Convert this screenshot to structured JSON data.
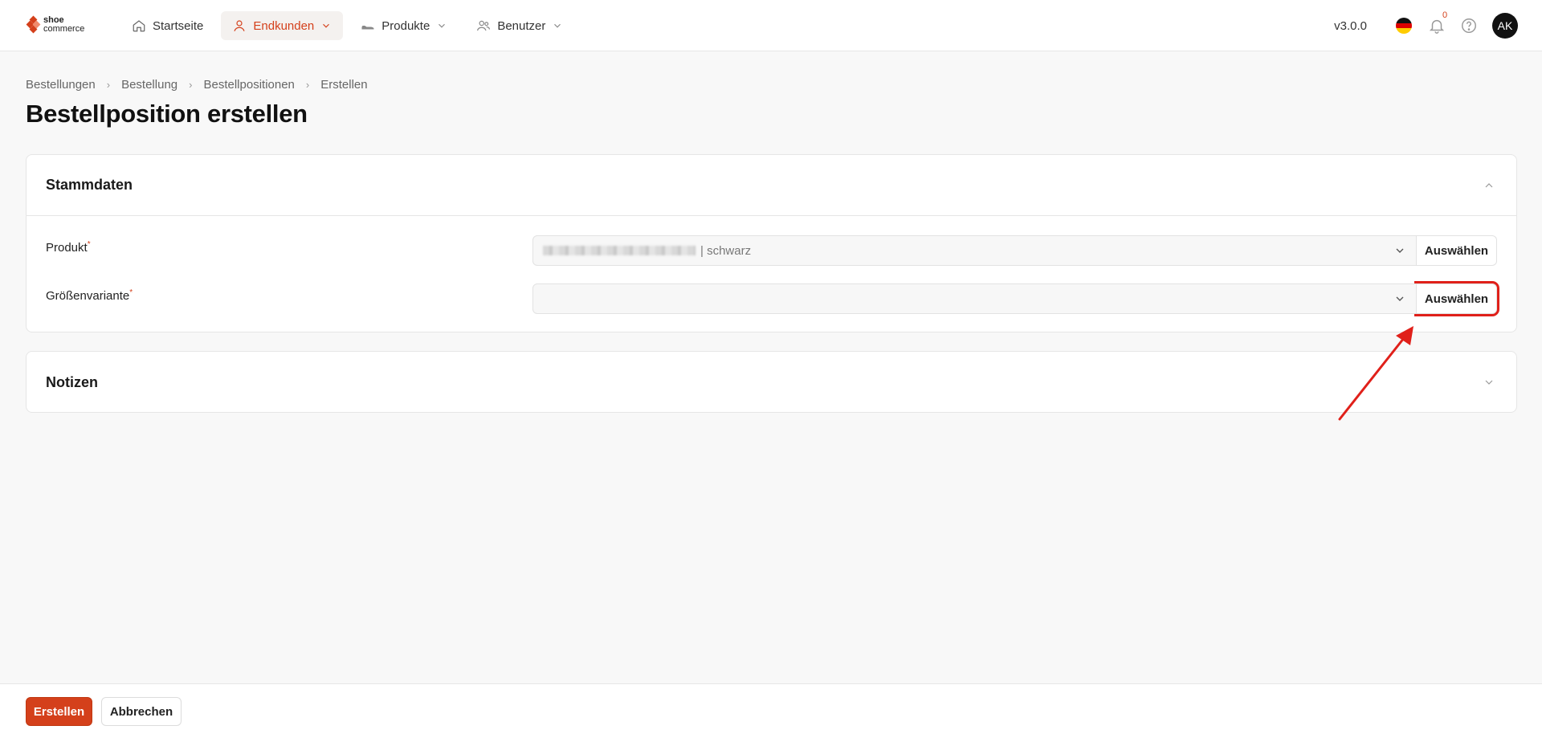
{
  "brand": {
    "logo_line1": "shoe",
    "logo_line2": "commerce"
  },
  "nav": {
    "items": [
      {
        "label": "Startseite",
        "icon": "home-icon"
      },
      {
        "label": "Endkunden",
        "icon": "user-icon",
        "active": true
      },
      {
        "label": "Produkte",
        "icon": "shoe-icon"
      },
      {
        "label": "Benutzer",
        "icon": "users-icon"
      }
    ],
    "version": "v3.0.0",
    "notification_count": "0",
    "avatar_initials": "AK"
  },
  "breadcrumb": [
    "Bestellungen",
    "Bestellung",
    "Bestellpositionen",
    "Erstellen"
  ],
  "page_title": "Bestellposition erstellen",
  "sections": {
    "stammdaten": {
      "title": "Stammdaten",
      "fields": {
        "produkt": {
          "label": "Produkt",
          "value_suffix": "| schwarz",
          "button": "Auswählen"
        },
        "groesse": {
          "label": "Größenvariante",
          "value": "",
          "button": "Auswählen"
        }
      }
    },
    "notizen": {
      "title": "Notizen"
    }
  },
  "footer": {
    "create": "Erstellen",
    "cancel": "Abbrechen"
  },
  "colors": {
    "accent": "#d4401b",
    "highlight": "#e0201a"
  }
}
